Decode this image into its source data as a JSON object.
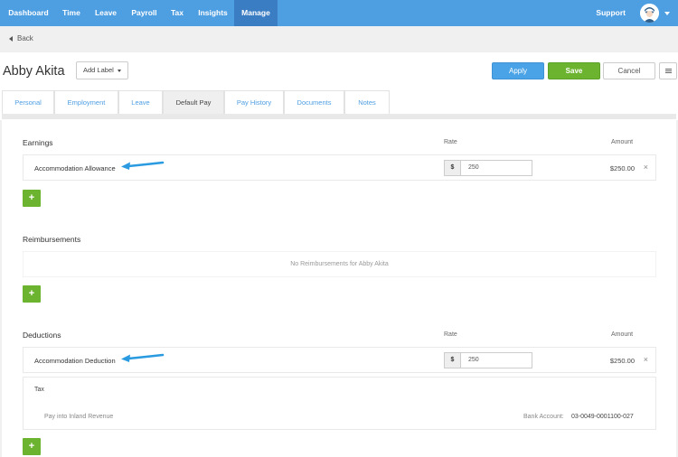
{
  "nav": {
    "items": [
      "Dashboard",
      "Time",
      "Leave",
      "Payroll",
      "Tax",
      "Insights",
      "Manage"
    ],
    "active": "Manage",
    "support": "Support"
  },
  "back": "Back",
  "employee": {
    "name": "Abby Akita"
  },
  "header": {
    "add_label": "Add Label",
    "apply": "Apply",
    "save": "Save",
    "cancel": "Cancel"
  },
  "tabs": [
    "Personal",
    "Employment",
    "Leave",
    "Default Pay",
    "Pay History",
    "Documents",
    "Notes"
  ],
  "active_tab": "Default Pay",
  "earnings": {
    "title": "Earnings",
    "col_rate": "Rate",
    "col_amount": "Amount",
    "rows": [
      {
        "label": "Accommodation Allowance",
        "currency": "$",
        "rate": "250",
        "amount": "$250.00"
      }
    ]
  },
  "reimbursements": {
    "title": "Reimbursements",
    "empty": "No Reimbursements for Abby Akita"
  },
  "deductions": {
    "title": "Deductions",
    "col_rate": "Rate",
    "col_amount": "Amount",
    "rows": [
      {
        "label": "Accommodation Deduction",
        "currency": "$",
        "rate": "250",
        "amount": "$250.00"
      }
    ]
  },
  "tax": {
    "title": "Tax",
    "pay_into": "Pay into Inland Revenue",
    "bank_label": "Bank Account:",
    "bank_account": "03-0049-0001100-027"
  },
  "icons": {
    "add": "+",
    "remove": "×"
  },
  "colors": {
    "nav": "#4e9ee2",
    "nav_active": "#3a7dc3",
    "apply": "#4aa3e6",
    "save": "#6cb42f",
    "add": "#6cb42f",
    "arrow": "#2a9be0"
  }
}
